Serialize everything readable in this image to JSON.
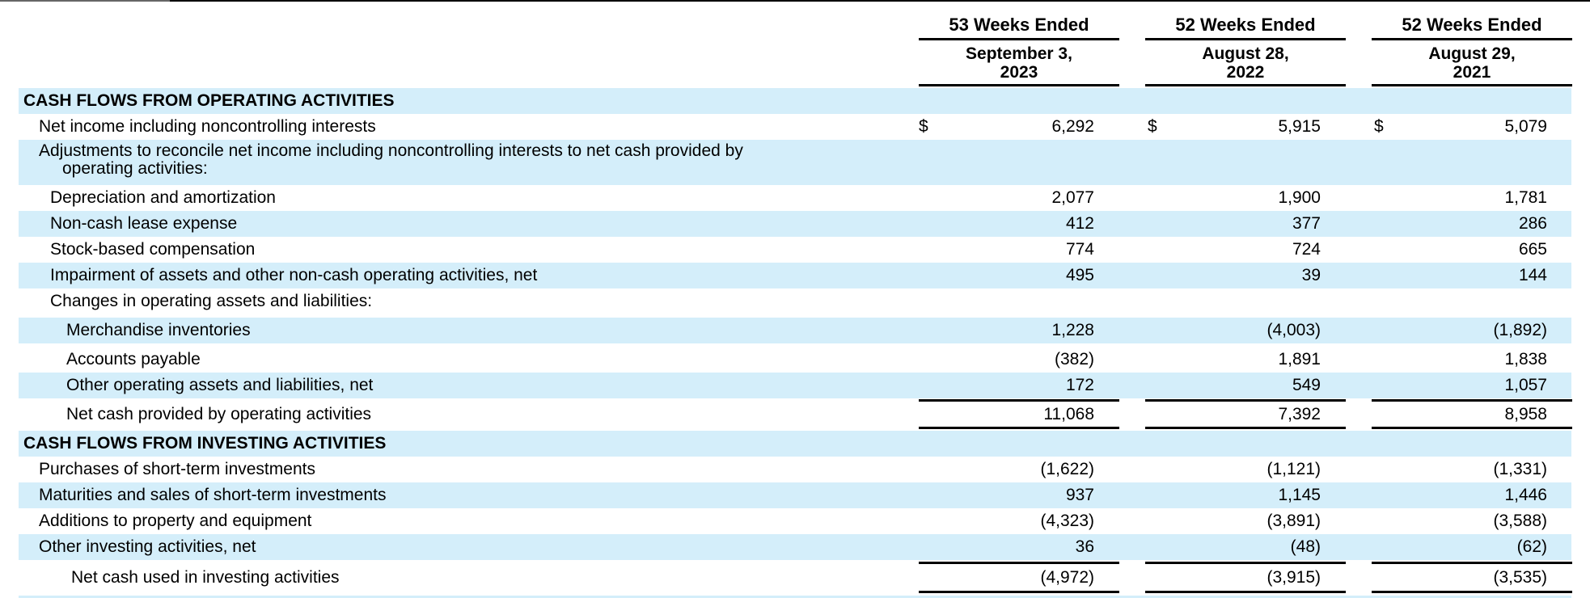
{
  "headers": [
    {
      "period": "53 Weeks Ended",
      "date_line1": "September 3,",
      "date_line2": "2023"
    },
    {
      "period": "52 Weeks Ended",
      "date_line1": "August 28,",
      "date_line2": "2022"
    },
    {
      "period": "52 Weeks Ended",
      "date_line1": "August 29,",
      "date_line2": "2021"
    }
  ],
  "currency_symbol": "$",
  "sections": {
    "operating": "CASH FLOWS FROM OPERATING ACTIVITIES",
    "investing": "CASH FLOWS FROM INVESTING ACTIVITIES"
  },
  "rows": {
    "net_income": {
      "label": "Net income including noncontrolling interests",
      "values": [
        "6,292",
        "5,915",
        "5,079"
      ]
    },
    "adjustments": {
      "label_line1": "Adjustments to reconcile net income including noncontrolling interests to net cash provided by",
      "label_line2": "operating activities:"
    },
    "depreciation": {
      "label": "Depreciation and amortization",
      "values": [
        "2,077",
        "1,900",
        "1,781"
      ]
    },
    "lease": {
      "label": "Non-cash lease expense",
      "values": [
        "412",
        "377",
        "286"
      ]
    },
    "stock_comp": {
      "label": "Stock-based compensation",
      "values": [
        "774",
        "724",
        "665"
      ]
    },
    "impairment": {
      "label": "Impairment of assets and other non-cash operating activities, net",
      "values": [
        "495",
        "39",
        "144"
      ]
    },
    "changes": {
      "label": "Changes in operating assets and liabilities:"
    },
    "inventories": {
      "label": "Merchandise inventories",
      "values": [
        "1,228",
        "(4,003)",
        "(1,892)"
      ]
    },
    "payable": {
      "label": "Accounts payable",
      "values": [
        "(382)",
        "1,891",
        "1,838"
      ]
    },
    "other_operating": {
      "label": "Other operating assets and liabilities, net",
      "values": [
        "172",
        "549",
        "1,057"
      ]
    },
    "net_operating": {
      "label": "Net cash provided by operating activities",
      "values": [
        "11,068",
        "7,392",
        "8,958"
      ]
    },
    "purchases_st": {
      "label": "Purchases of short-term investments",
      "values": [
        "(1,622)",
        "(1,121)",
        "(1,331)"
      ]
    },
    "maturities_st": {
      "label": "Maturities and sales of short-term investments",
      "values": [
        "937",
        "1,145",
        "1,446"
      ]
    },
    "additions_ppe": {
      "label": "Additions to property and equipment",
      "values": [
        "(4,323)",
        "(3,891)",
        "(3,588)"
      ]
    },
    "other_investing": {
      "label": "Other investing activities, net",
      "values": [
        "36",
        "(48)",
        "(62)"
      ]
    },
    "net_investing": {
      "label": "Net cash used in investing activities",
      "values": [
        "(4,972)",
        "(3,915)",
        "(3,535)"
      ]
    }
  }
}
